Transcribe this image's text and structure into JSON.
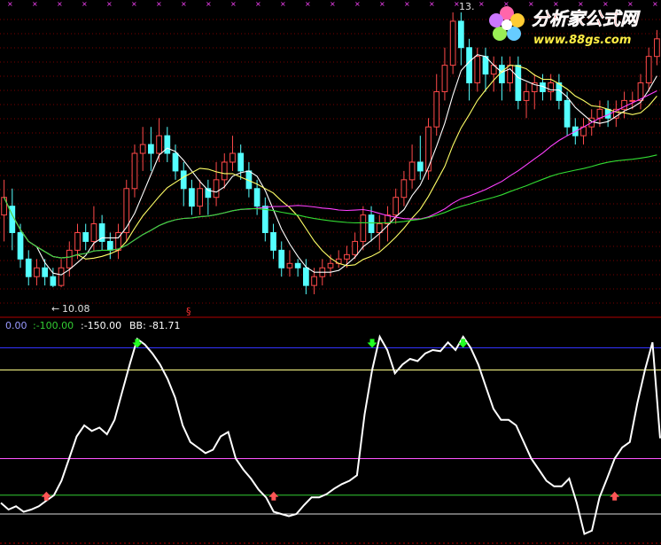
{
  "logo": {
    "title": "分析家公式网",
    "url": "www.88gs.com"
  },
  "colors": {
    "background": "#000000",
    "up_candle": "#ff4a4a",
    "down_candle": "#54ffff",
    "ma_short": "#ffffff",
    "ma_mid": "#ffff66",
    "ma_long": "#ff40ff",
    "ma_longest": "#33dd33",
    "osc_line": "#ffffff",
    "level_0": "#9999ff",
    "level_minus100": "#33cc33",
    "level_minus150": "#ffffff",
    "level_top_blue": "#3333ff",
    "level_yellow": "#ffff88",
    "level_magenta": "#ff55ff",
    "level_white_bottom": "#dddddd",
    "signal_down": "#22ff22",
    "signal_up": "#ff5555"
  },
  "chart_data": [
    {
      "type": "candlestick",
      "title": "",
      "annotations": [
        {
          "text": "13.",
          "kind": "high"
        },
        {
          "text": "10.08",
          "kind": "low"
        },
        {
          "text": "§",
          "kind": "marker"
        }
      ],
      "price_range": [
        9.9,
        13.2
      ],
      "series": [
        {
          "name": "MA short",
          "color": "#ffffff"
        },
        {
          "name": "MA mid",
          "color": "#ffff66"
        },
        {
          "name": "MA long",
          "color": "#ff40ff"
        },
        {
          "name": "MA longest",
          "color": "#33dd33"
        }
      ],
      "candles": [
        [
          10.9,
          11.1,
          10.6,
          11.3
        ],
        [
          11.0,
          10.7,
          10.5,
          11.2
        ],
        [
          10.7,
          10.4,
          10.3,
          10.8
        ],
        [
          10.4,
          10.2,
          10.1,
          10.5
        ],
        [
          10.2,
          10.3,
          10.1,
          10.4
        ],
        [
          10.3,
          10.2,
          10.1,
          10.4
        ],
        [
          10.2,
          10.1,
          10.08,
          10.3
        ],
        [
          10.1,
          10.3,
          10.08,
          10.4
        ],
        [
          10.3,
          10.5,
          10.2,
          10.6
        ],
        [
          10.5,
          10.7,
          10.4,
          10.8
        ],
        [
          10.7,
          10.6,
          10.5,
          10.8
        ],
        [
          10.6,
          10.8,
          10.5,
          11.0
        ],
        [
          10.8,
          10.6,
          10.5,
          10.9
        ],
        [
          10.6,
          10.5,
          10.4,
          10.7
        ],
        [
          10.5,
          10.7,
          10.4,
          10.8
        ],
        [
          10.7,
          11.2,
          10.6,
          11.3
        ],
        [
          11.2,
          11.6,
          11.1,
          11.7
        ],
        [
          11.6,
          11.7,
          11.4,
          11.9
        ],
        [
          11.7,
          11.6,
          11.4,
          11.9
        ],
        [
          11.6,
          11.8,
          11.5,
          12.0
        ],
        [
          11.8,
          11.6,
          11.5,
          11.9
        ],
        [
          11.6,
          11.4,
          11.3,
          11.7
        ],
        [
          11.4,
          11.2,
          11.0,
          11.5
        ],
        [
          11.2,
          11.0,
          10.9,
          11.3
        ],
        [
          11.0,
          11.2,
          10.9,
          11.3
        ],
        [
          11.2,
          11.1,
          10.9,
          11.3
        ],
        [
          11.1,
          11.3,
          11.0,
          11.5
        ],
        [
          11.3,
          11.5,
          11.2,
          11.6
        ],
        [
          11.5,
          11.6,
          11.4,
          11.8
        ],
        [
          11.6,
          11.4,
          11.3,
          11.7
        ],
        [
          11.4,
          11.2,
          11.1,
          11.5
        ],
        [
          11.2,
          11.0,
          10.9,
          11.3
        ],
        [
          11.0,
          10.7,
          10.6,
          11.1
        ],
        [
          10.7,
          10.5,
          10.4,
          10.8
        ],
        [
          10.5,
          10.3,
          10.2,
          10.6
        ],
        [
          10.3,
          10.35,
          10.2,
          10.5
        ],
        [
          10.35,
          10.3,
          10.2,
          10.4
        ],
        [
          10.3,
          10.1,
          10.0,
          10.4
        ],
        [
          10.1,
          10.2,
          10.0,
          10.3
        ],
        [
          10.2,
          10.3,
          10.1,
          10.4
        ],
        [
          10.3,
          10.35,
          10.2,
          10.45
        ],
        [
          10.35,
          10.4,
          10.3,
          10.5
        ],
        [
          10.4,
          10.45,
          10.3,
          10.55
        ],
        [
          10.45,
          10.6,
          10.4,
          10.7
        ],
        [
          10.6,
          10.9,
          10.5,
          11.0
        ],
        [
          10.9,
          10.7,
          10.6,
          11.0
        ],
        [
          10.7,
          10.8,
          10.5,
          10.9
        ],
        [
          10.8,
          10.9,
          10.6,
          11.0
        ],
        [
          10.9,
          11.1,
          10.8,
          11.2
        ],
        [
          11.1,
          11.3,
          11.0,
          11.4
        ],
        [
          11.3,
          11.5,
          11.2,
          11.7
        ],
        [
          11.5,
          11.4,
          11.3,
          11.8
        ],
        [
          11.4,
          11.9,
          11.3,
          12.0
        ],
        [
          11.9,
          12.3,
          11.8,
          12.5
        ],
        [
          12.3,
          12.6,
          12.2,
          12.8
        ],
        [
          12.6,
          13.1,
          12.5,
          13.2
        ],
        [
          13.1,
          12.8,
          12.6,
          13.2
        ],
        [
          12.8,
          12.4,
          12.2,
          12.9
        ],
        [
          12.4,
          12.7,
          12.3,
          12.8
        ],
        [
          12.7,
          12.5,
          12.3,
          12.8
        ],
        [
          12.5,
          12.6,
          12.3,
          12.7
        ],
        [
          12.6,
          12.4,
          12.2,
          12.7
        ],
        [
          12.4,
          12.6,
          12.3,
          12.7
        ],
        [
          12.6,
          12.2,
          12.1,
          12.7
        ],
        [
          12.2,
          12.3,
          12.0,
          12.4
        ],
        [
          12.3,
          12.4,
          12.1,
          12.5
        ],
        [
          12.4,
          12.3,
          12.2,
          12.5
        ],
        [
          12.3,
          12.4,
          12.2,
          12.5
        ],
        [
          12.4,
          12.2,
          12.1,
          12.5
        ],
        [
          12.2,
          11.9,
          11.8,
          12.3
        ],
        [
          11.9,
          11.8,
          11.7,
          12.0
        ],
        [
          11.8,
          11.9,
          11.7,
          12.0
        ],
        [
          11.9,
          12.0,
          11.8,
          12.1
        ],
        [
          12.0,
          12.1,
          11.9,
          12.2
        ],
        [
          12.1,
          12.0,
          11.9,
          12.2
        ],
        [
          12.0,
          12.1,
          11.9,
          12.2
        ],
        [
          12.1,
          12.2,
          12.0,
          12.3
        ],
        [
          12.2,
          12.2,
          12.1,
          12.3
        ],
        [
          12.2,
          12.4,
          12.1,
          12.5
        ],
        [
          12.4,
          12.7,
          12.3,
          12.8
        ],
        [
          12.7,
          12.9,
          12.6,
          13.0
        ]
      ]
    },
    {
      "type": "line",
      "title": "",
      "legend": [
        {
          "text": "0.00",
          "color": "#9999ff"
        },
        {
          "text": ":-100.00",
          "color": "#33cc33"
        },
        {
          "text": ":-150.00",
          "color": "#ffffff"
        },
        {
          "text": "BB:",
          "color": "#ffffff"
        },
        {
          "text": "-81.71",
          "color": "#ffffff"
        }
      ],
      "ylim": [
        -170,
        10
      ],
      "levels": [
        {
          "value": 0,
          "color": "#3333ff"
        },
        {
          "value": -20,
          "color": "#ffff88"
        },
        {
          "value": -100,
          "color": "#ff55ff"
        },
        {
          "value": -133,
          "color": "#33cc33"
        },
        {
          "value": -150,
          "color": "#dddddd"
        }
      ],
      "series": [
        {
          "name": "BB",
          "values": [
            -140,
            -146,
            -143,
            -148,
            -146,
            -143,
            -138,
            -133,
            -120,
            -100,
            -80,
            -70,
            -75,
            -72,
            -78,
            -65,
            -40,
            -15,
            8,
            3,
            -5,
            -15,
            -28,
            -45,
            -70,
            -85,
            -90,
            -95,
            -92,
            -80,
            -76,
            -100,
            -110,
            -118,
            -128,
            -135,
            -148,
            -150,
            -152,
            -150,
            -142,
            -135,
            -135,
            -132,
            -127,
            -123,
            -120,
            -115,
            -60,
            -20,
            10,
            -2,
            -23,
            -15,
            -10,
            -12,
            -5,
            -2,
            -3,
            5,
            -2,
            10,
            0,
            -15,
            -35,
            -55,
            -65,
            -65,
            -70,
            -85,
            -100,
            -110,
            -120,
            -125,
            -125,
            -118,
            -140,
            -168,
            -165,
            -135,
            -118,
            -100,
            -90,
            -85,
            -50,
            -20,
            5,
            -81.71
          ]
        }
      ],
      "signals": [
        {
          "index": 6,
          "kind": "buy"
        },
        {
          "index": 18,
          "kind": "sell"
        },
        {
          "index": 36,
          "kind": "buy"
        },
        {
          "index": 49,
          "kind": "sell"
        },
        {
          "index": 61,
          "kind": "sell"
        },
        {
          "index": 81,
          "kind": "buy"
        }
      ]
    }
  ]
}
